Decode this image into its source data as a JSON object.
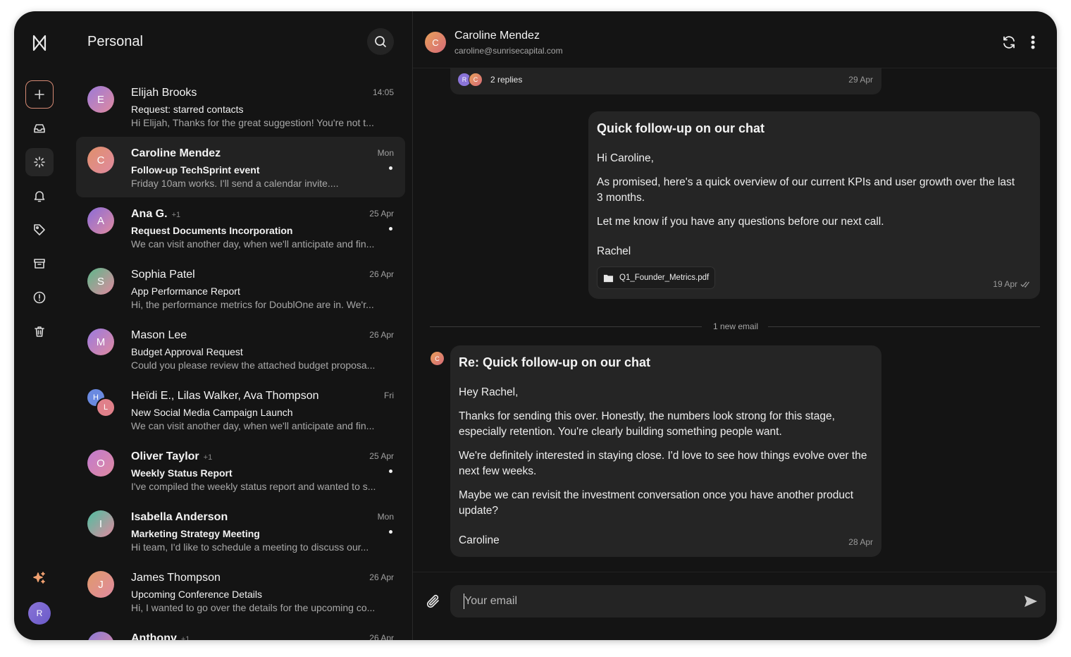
{
  "rail": {
    "items": [
      {
        "name": "compose"
      },
      {
        "name": "inbox"
      },
      {
        "name": "highlights"
      },
      {
        "name": "notifications"
      },
      {
        "name": "tags"
      },
      {
        "name": "archive"
      },
      {
        "name": "spam"
      },
      {
        "name": "trash"
      }
    ],
    "ai_icon": "sparkles-icon",
    "avatar_initial": "R"
  },
  "list": {
    "title": "Personal",
    "threads": [
      {
        "initial": "E",
        "name": "Elijah Brooks",
        "count": "",
        "time": "14:05",
        "subject": "Request: starred contacts",
        "preview": "Hi Elijah, Thanks for the great suggestion! You're not t...",
        "unread": false,
        "color": "#9b7ad8"
      },
      {
        "initial": "C",
        "name": "Caroline Mendez",
        "count": "",
        "time": "Mon",
        "subject": "Follow-up TechSprint event",
        "preview": "Friday 10am works. I'll send a calendar invite....",
        "unread": true,
        "color": "#e0906a"
      },
      {
        "initial": "A",
        "name": "Ana G.",
        "count": "+1",
        "time": "25 Apr",
        "subject": "Request Documents Incorporation",
        "preview": "We can visit another day, when we'll anticipate and fin...",
        "unread": true,
        "color": "#8a6cd8"
      },
      {
        "initial": "S",
        "name": "Sophia Patel",
        "count": "",
        "time": "26 Apr",
        "subject": "App Performance Report",
        "preview": "Hi, the performance metrics for DoublOne are in. We'r...",
        "unread": false,
        "color": "#5cb88a"
      },
      {
        "initial": "M",
        "name": "Mason Lee",
        "count": "",
        "time": "26 Apr",
        "subject": "Budget Approval Request",
        "preview": "Could you please review the attached budget proposa...",
        "unread": false,
        "color": "#9a7ae0"
      },
      {
        "initial": "H",
        "initial2": "L",
        "name": "Heïdi E., Lilas Walker, Ava Thompson",
        "count": "",
        "time": "Fri",
        "subject": "New Social Media Campaign Launch",
        "preview": "We can visit another day, when we'll anticipate and fin...",
        "unread": false,
        "color": "#6a8ae0",
        "color2": "#e0808a"
      },
      {
        "initial": "O",
        "name": "Oliver Taylor",
        "count": "+1",
        "time": "25 Apr",
        "subject": "Weekly Status Report",
        "preview": "I've compiled the weekly status report and wanted to s...",
        "unread": true,
        "color": "#c07ad0"
      },
      {
        "initial": "I",
        "name": "Isabella Anderson",
        "count": "",
        "time": "Mon",
        "subject": "Marketing Strategy Meeting",
        "preview": "Hi team, I'd like to schedule a meeting to discuss our...",
        "unread": true,
        "color": "#4cc0a0"
      },
      {
        "initial": "J",
        "name": "James Thompson",
        "count": "",
        "time": "26 Apr",
        "subject": "Upcoming Conference Details",
        "preview": "Hi, I wanted to go over the details for the upcoming co...",
        "unread": false,
        "color": "#e09a6a"
      },
      {
        "initial": "A",
        "name": "Anthony",
        "count": "+1",
        "time": "26 Apr",
        "subject": "",
        "preview": "",
        "unread": true,
        "color": "#8a7ad8"
      }
    ]
  },
  "reader": {
    "contact_initial": "C",
    "contact_name": "Caroline Mendez",
    "contact_email": "caroline@sunrisecapital.com",
    "replies": {
      "label": "2 replies",
      "date": "29 Apr",
      "avatars": [
        "R",
        "C"
      ]
    },
    "sent": {
      "title": "Quick follow-up on our chat",
      "greeting": "Hi Caroline,",
      "p1": "As promised, here's a quick overview of our current KPIs and user growth over the last 3 months.",
      "p2": "Let me know if you have any questions before our next call.",
      "sign": "Rachel",
      "attachment": "Q1_Founder_Metrics.pdf",
      "date": "19 Apr"
    },
    "divider_label": "1 new email",
    "reply_initial": "C",
    "received": {
      "title": "Re: Quick follow-up on our chat",
      "greeting": "Hey Rachel,",
      "p1": "Thanks for sending this over. Honestly, the numbers look strong for this stage, especially retention. You're clearly building something people want.",
      "p2": "We're definitely interested in staying close. I'd love to see how things evolve over the next few weeks.",
      "p3": "Maybe we can revisit the investment conversation once you have another product update?",
      "sign": "Caroline",
      "date": "28 Apr"
    },
    "composer_placeholder": "Your email"
  }
}
